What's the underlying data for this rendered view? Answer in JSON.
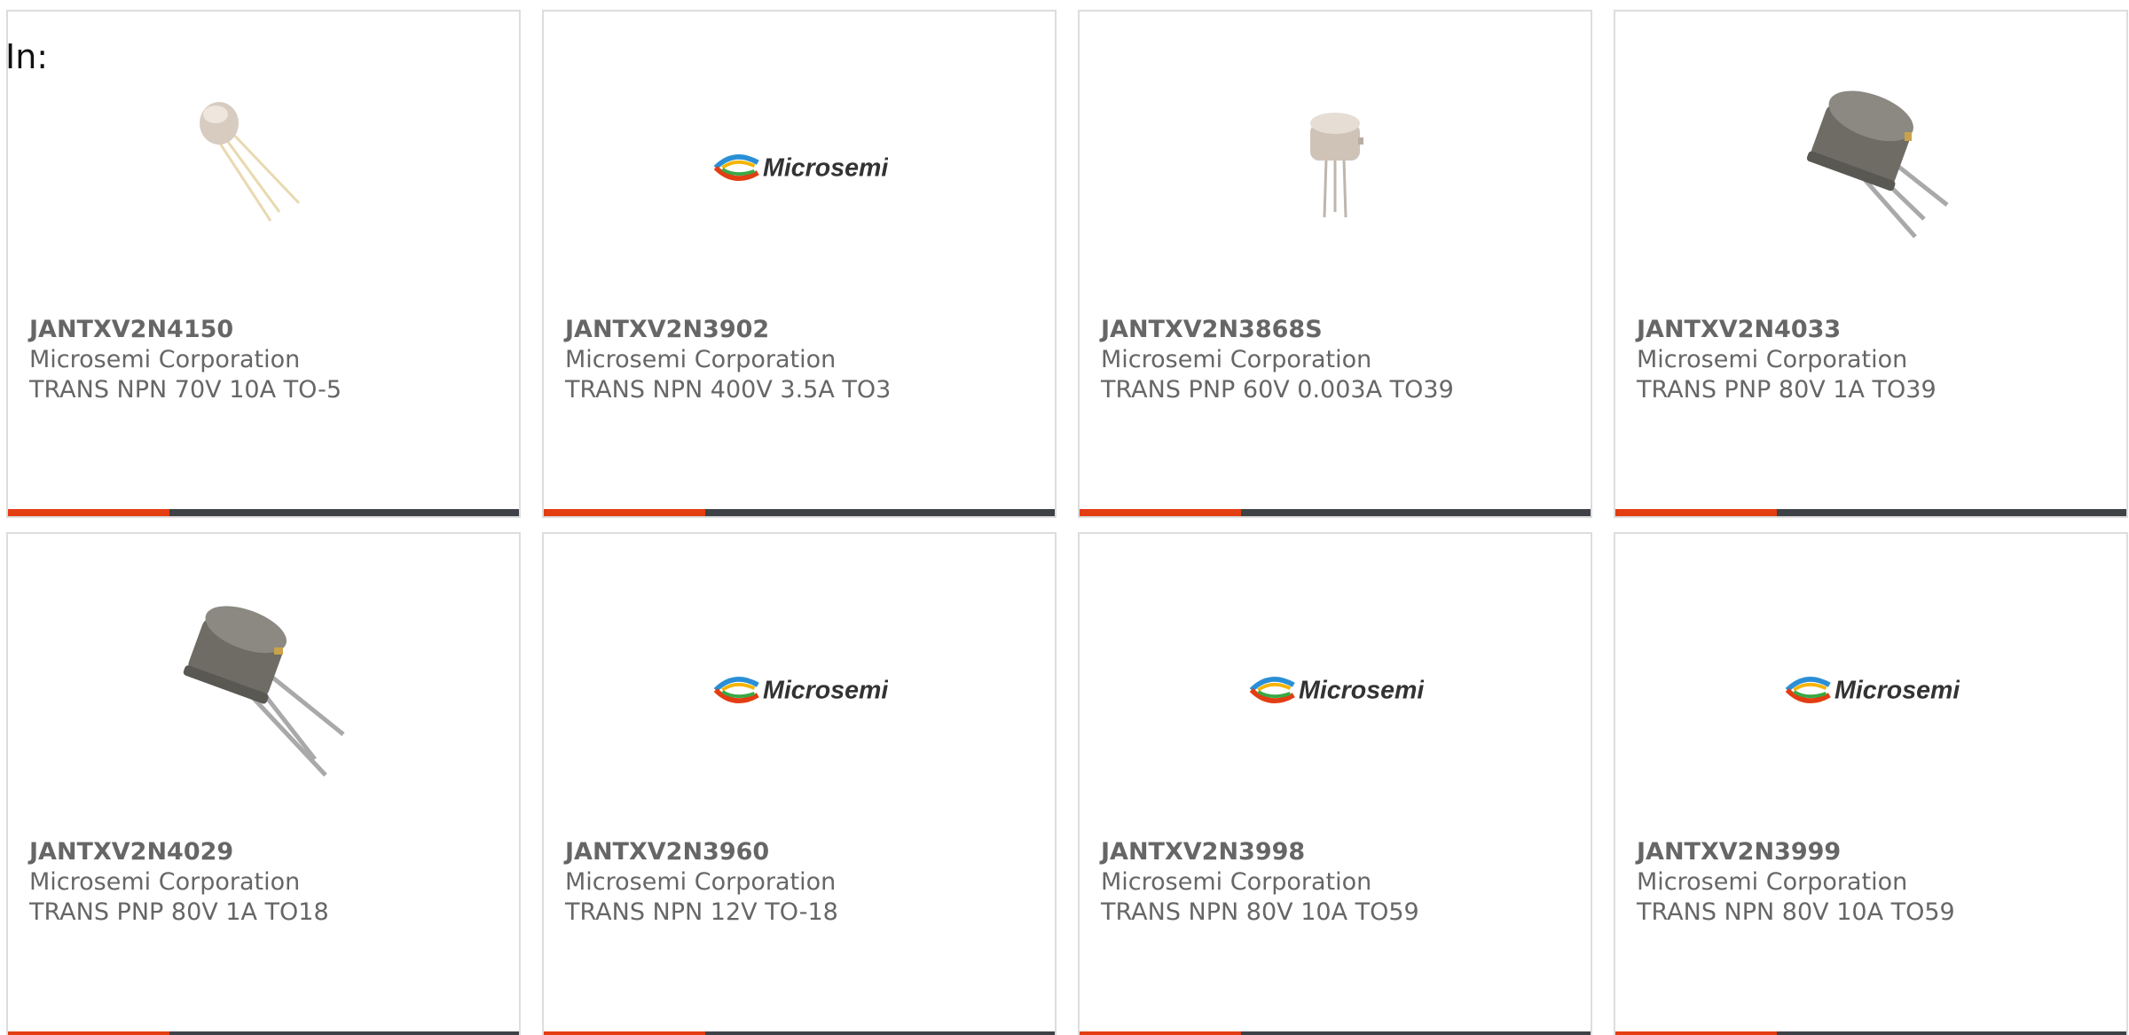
{
  "header": {
    "in_label": "In:"
  },
  "colors": {
    "accent": "#e33d12",
    "bar": "#3e4146",
    "card_border": "#dddddd",
    "text": "#666666"
  },
  "products": [
    {
      "part_number": "JANTXV2N4150",
      "manufacturer": "Microsemi Corporation",
      "description": "TRANS NPN 70V 10A TO-5",
      "image": "to-can-transistor-small-photo"
    },
    {
      "part_number": "JANTXV2N3902",
      "manufacturer": "Microsemi Corporation",
      "description": "TRANS NPN 400V 3.5A TO3",
      "image": "microsemi-logo",
      "logo_text": "Microsemi"
    },
    {
      "part_number": "JANTXV2N3868S",
      "manufacturer": "Microsemi Corporation",
      "description": "TRANS PNP 60V 0.003A TO39",
      "image": "to-can-transistor-upright-photo"
    },
    {
      "part_number": "JANTXV2N4033",
      "manufacturer": "Microsemi Corporation",
      "description": "TRANS PNP 80V 1A TO39",
      "image": "to-can-transistor-metal-photo"
    },
    {
      "part_number": "JANTXV2N4029",
      "manufacturer": "Microsemi Corporation",
      "description": "TRANS PNP 80V 1A TO18",
      "image": "to-can-transistor-metal-photo"
    },
    {
      "part_number": "JANTXV2N3960",
      "manufacturer": "Microsemi Corporation",
      "description": "TRANS NPN 12V TO-18",
      "image": "microsemi-logo",
      "logo_text": "Microsemi"
    },
    {
      "part_number": "JANTXV2N3998",
      "manufacturer": "Microsemi Corporation",
      "description": "TRANS NPN 80V 10A TO59",
      "image": "microsemi-logo",
      "logo_text": "Microsemi"
    },
    {
      "part_number": "JANTXV2N3999",
      "manufacturer": "Microsemi Corporation",
      "description": "TRANS NPN 80V 10A TO59",
      "image": "microsemi-logo",
      "logo_text": "Microsemi"
    }
  ]
}
